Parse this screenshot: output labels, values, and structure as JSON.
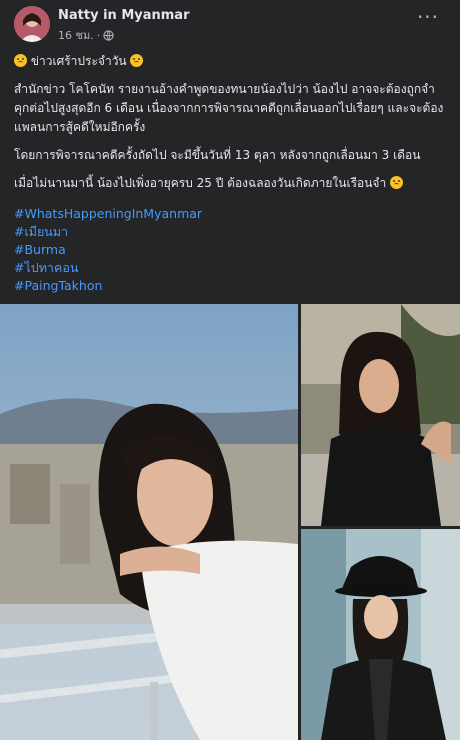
{
  "post": {
    "author": "Natty in Myanmar",
    "time": "16 ชม.",
    "paragraphs": [
      "ข่าวเศร้าประจำวัน",
      "สำนักข่าว โคโคนัท รายงานอ้างคำพูดของทนายน้องไปว่า  น้องไป อาจจะต้องถูกจำคุกต่อไปสูงสุดอีก 6 เดือน เนื่องจากการพิจารณาคดีถูกเลื่อนออกไปเรื่อยๆ และจะต้องแพลนการสู้คดีใหม่อีกครั้ง",
      "โดยการพิจารณาคดีครั้งถัดไป จะมีขึ้นวันที่ 13 ตุลา หลังจากถูกเลื่อนมา 3 เดือน",
      "เมื่อไม่นานมานี้ น้องไปเพิ่งอายุครบ 25 ปี ต้องฉลองวันเกิดภายในเรือนจำ"
    ],
    "hashtags": [
      "#WhatsHappeningInMyanmar",
      "#เมียนมา",
      "#Burma",
      "#ไปทาคอน",
      "#PaingTakhon"
    ]
  },
  "icons": {
    "more": "more-options-icon",
    "audience": "globe-icon",
    "emoji": "sad-face-emoji"
  },
  "colors": {
    "card_bg": "#242526",
    "text": "#e4e6eb",
    "secondary": "#b0b3b8",
    "link": "#4599ff"
  }
}
